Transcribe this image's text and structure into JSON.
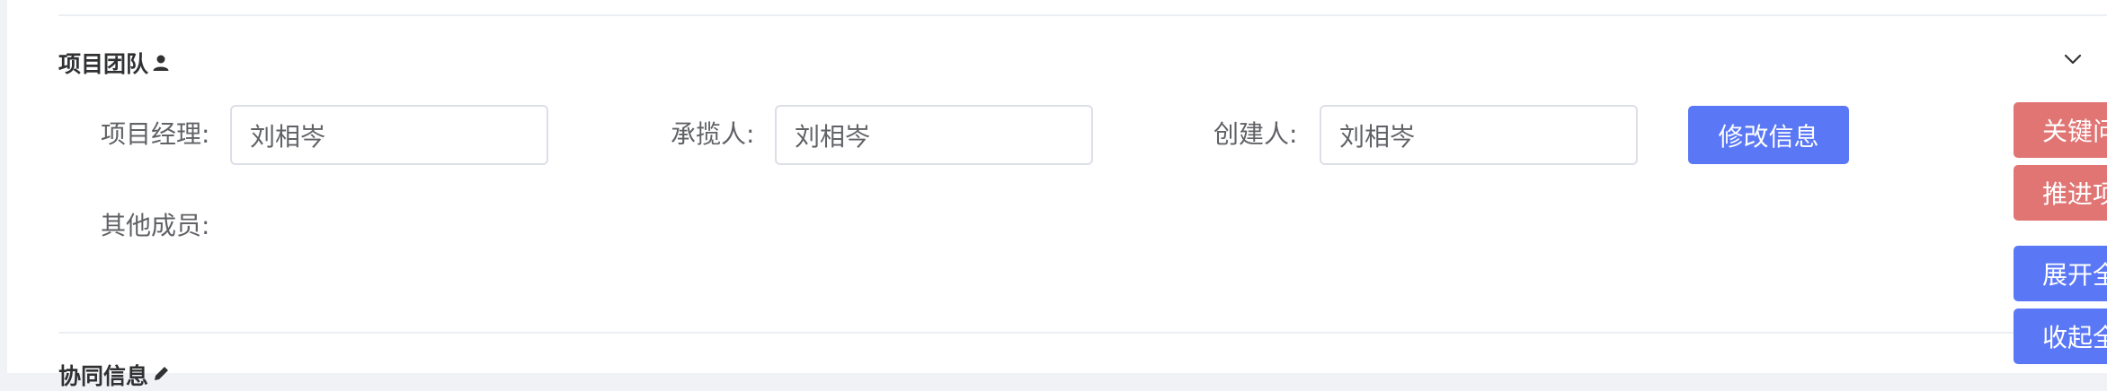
{
  "team_section": {
    "title": "项目团队",
    "icon": "person-icon",
    "collapse_icon": "chevron-down-icon"
  },
  "fields": {
    "manager_label": "项目经理:",
    "manager_value": "刘相岑",
    "contractor_label": "承揽人:",
    "contractor_value": "刘相岑",
    "creator_label": "创建人:",
    "creator_value": "刘相岑",
    "other_members_label": "其他成员:"
  },
  "actions": {
    "edit_label": "修改信息"
  },
  "side_buttons": {
    "key_issue": "关键问",
    "advance": "推进项",
    "expand_all": "展开全",
    "collapse_all": "收起全"
  },
  "next_section": {
    "title": "协同信息",
    "icon": "edit-icon"
  },
  "colors": {
    "primary": "#5a78f5",
    "danger": "#e07574",
    "border": "#dcdfe6",
    "label": "#606266"
  }
}
